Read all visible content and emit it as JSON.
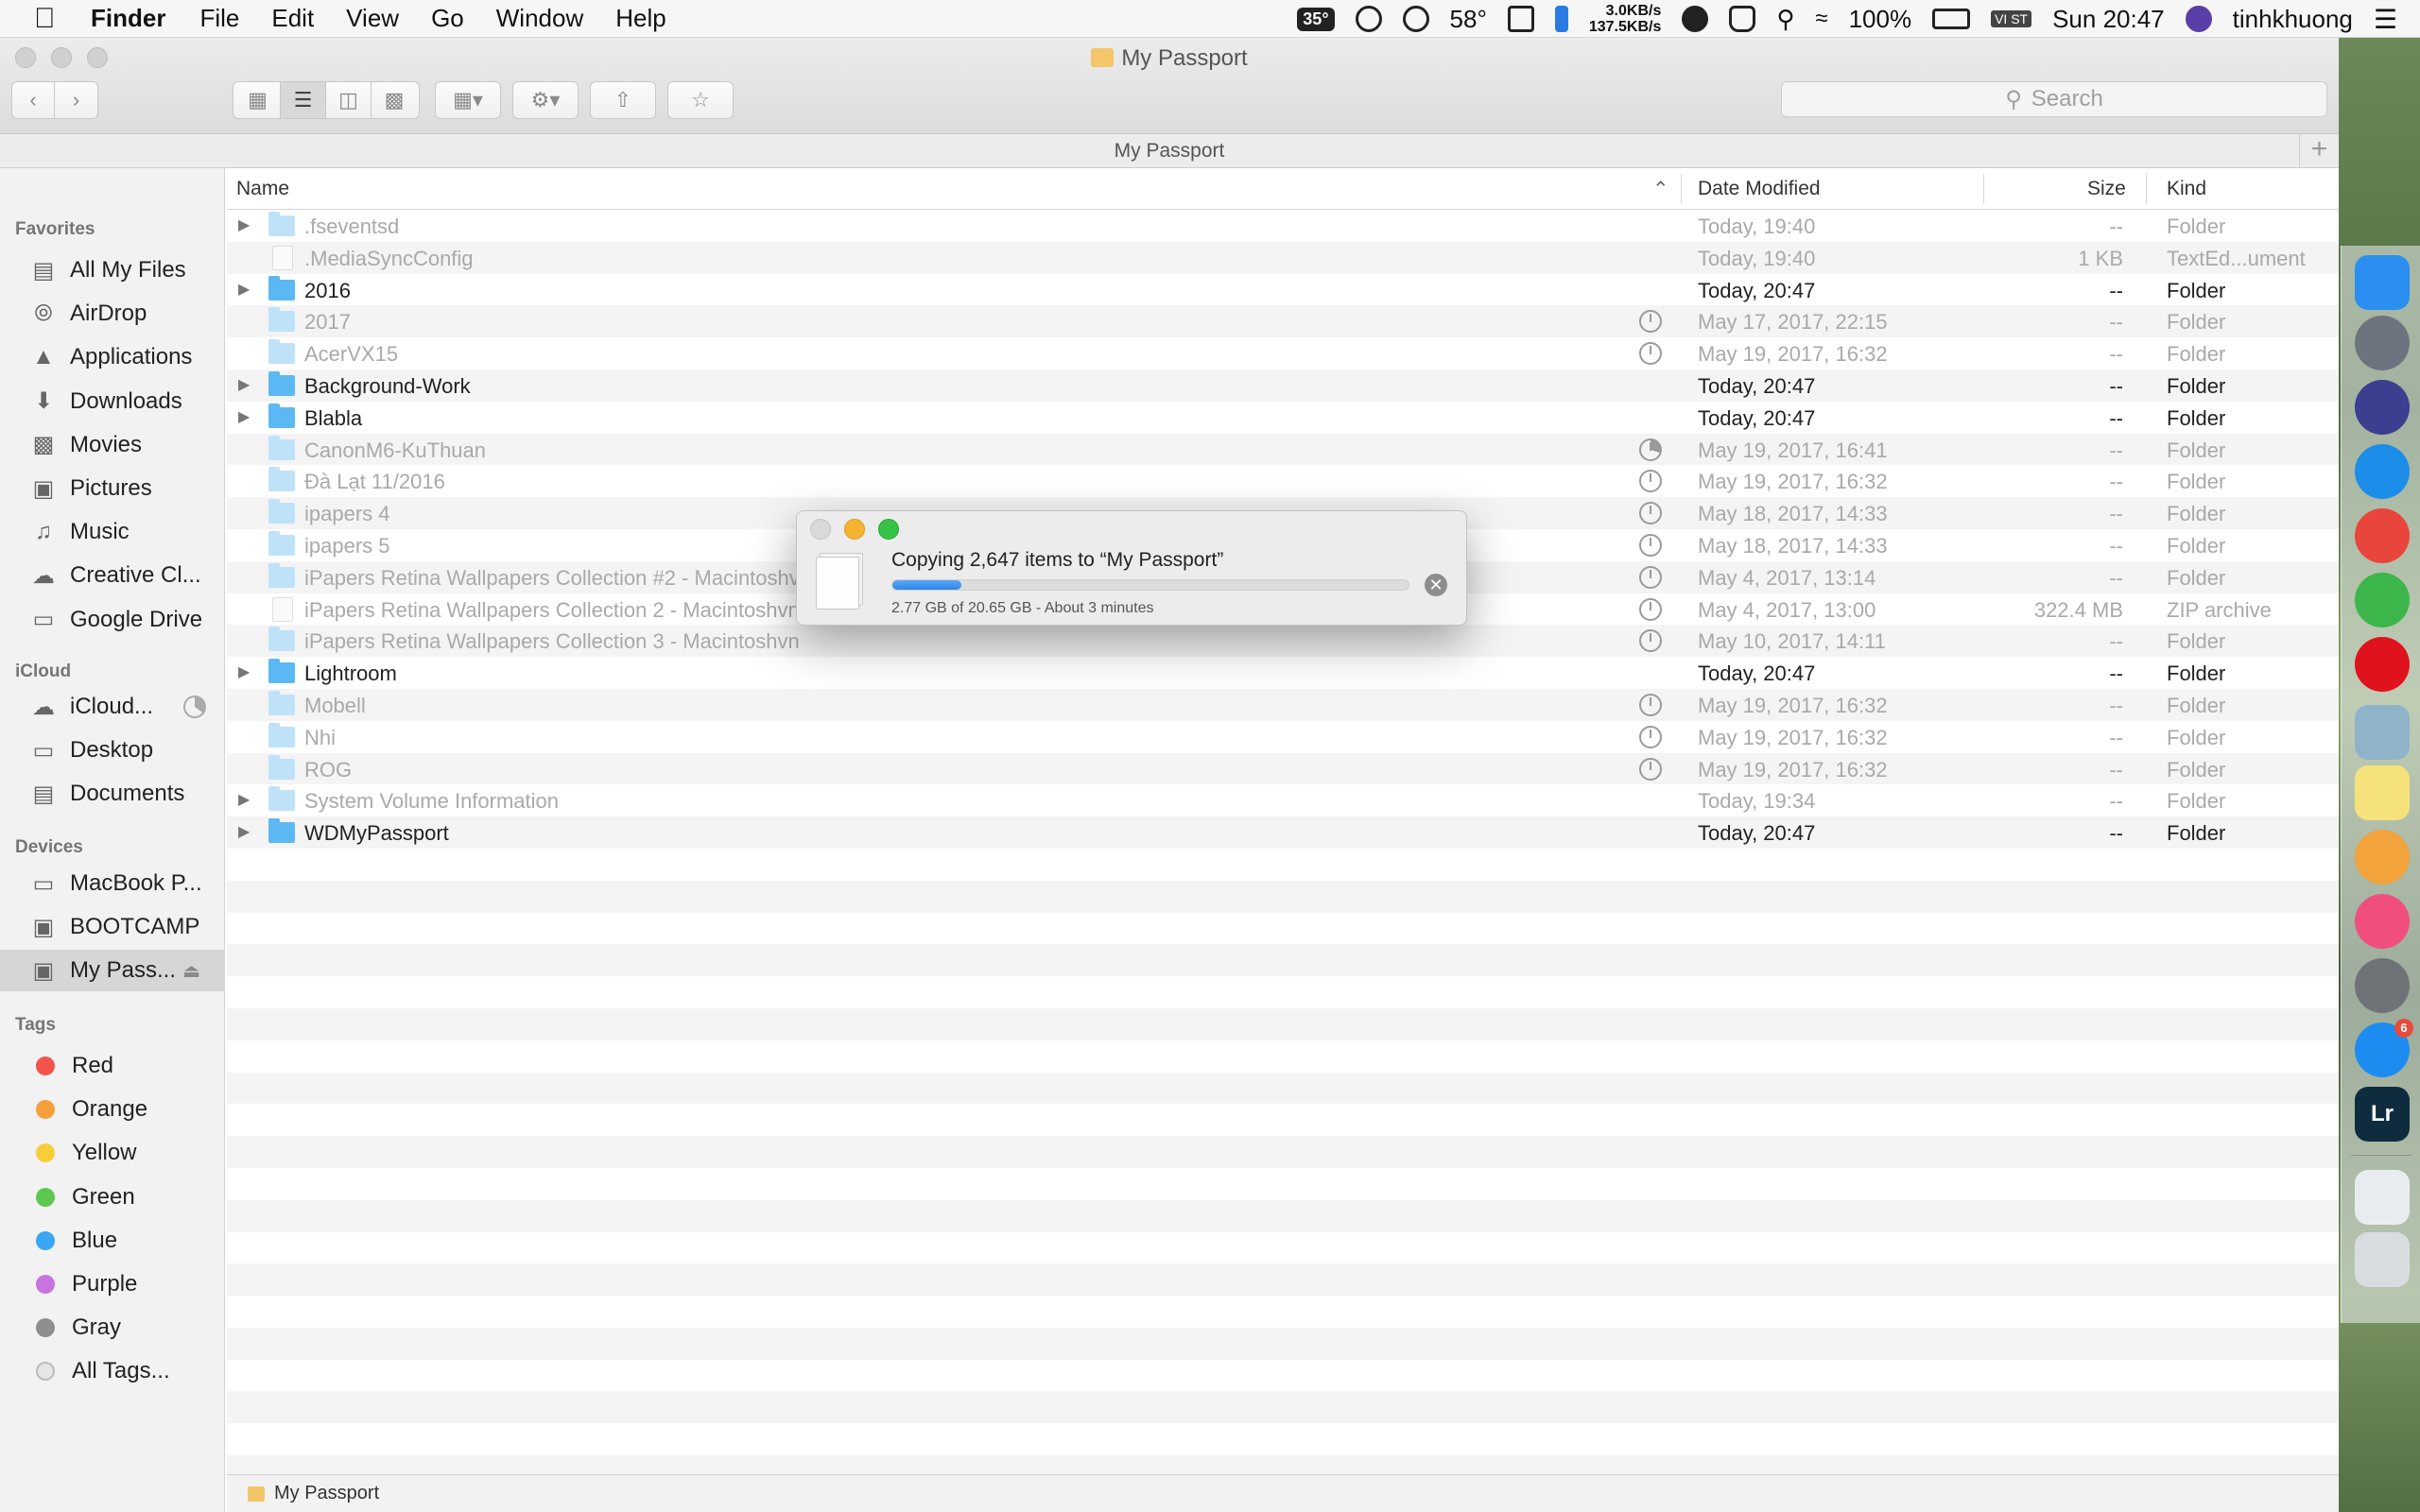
{
  "menubar": {
    "app_name": "Finder",
    "menus": [
      "File",
      "Edit",
      "View",
      "Go",
      "Window",
      "Help"
    ],
    "temperature_badge": "35°",
    "weather": "58°",
    "net_up": "3.0KB/s",
    "net_down": "137.5KB/s",
    "battery": "100%",
    "input_method": "VI ST",
    "clock": "Sun 20:47",
    "user": "tinhkhuong"
  },
  "window": {
    "title": "My Passport",
    "path_title": "My Passport",
    "search_placeholder": "Search",
    "status_path": "My Passport"
  },
  "sidebar": {
    "favorites_header": "Favorites",
    "favorites": [
      {
        "label": "All My Files",
        "icon": "all-files-icon"
      },
      {
        "label": "AirDrop",
        "icon": "airdrop-icon"
      },
      {
        "label": "Applications",
        "icon": "applications-icon"
      },
      {
        "label": "Downloads",
        "icon": "downloads-icon"
      },
      {
        "label": "Movies",
        "icon": "movies-icon"
      },
      {
        "label": "Pictures",
        "icon": "pictures-icon"
      },
      {
        "label": "Music",
        "icon": "music-icon"
      },
      {
        "label": "Creative Cl...",
        "icon": "creative-cloud-icon"
      },
      {
        "label": "Google Drive",
        "icon": "folder-icon"
      }
    ],
    "icloud_header": "iCloud",
    "icloud": [
      {
        "label": "iCloud...",
        "icon": "icloud-icon"
      },
      {
        "label": "Desktop",
        "icon": "desktop-icon"
      },
      {
        "label": "Documents",
        "icon": "documents-icon"
      }
    ],
    "devices_header": "Devices",
    "devices": [
      {
        "label": "MacBook P...",
        "icon": "laptop-icon"
      },
      {
        "label": "BOOTCAMP",
        "icon": "disk-icon"
      },
      {
        "label": "My Pass...",
        "icon": "disk-icon",
        "selected": true
      }
    ],
    "tags_header": "Tags",
    "tags": [
      {
        "label": "Red",
        "color": "#f2544c"
      },
      {
        "label": "Orange",
        "color": "#f6a03c"
      },
      {
        "label": "Yellow",
        "color": "#f7cd3a"
      },
      {
        "label": "Green",
        "color": "#5cc84f"
      },
      {
        "label": "Blue",
        "color": "#3aa7f4"
      },
      {
        "label": "Purple",
        "color": "#c874e0"
      },
      {
        "label": "Gray",
        "color": "#8e8e8e"
      },
      {
        "label": "All Tags...",
        "color": "#e6e6e6"
      }
    ]
  },
  "list": {
    "columns": {
      "name": "Name",
      "date": "Date Modified",
      "size": "Size",
      "kind": "Kind"
    },
    "rows": [
      {
        "name": ".fseventsd",
        "date": "Today, 19:40",
        "size": "--",
        "kind": "Folder",
        "dim": true,
        "disclosure": true,
        "type": "folder",
        "clock": ""
      },
      {
        "name": ".MediaSyncConfig",
        "date": "Today, 19:40",
        "size": "1 KB",
        "kind": "TextEd...ument",
        "dim": true,
        "disclosure": false,
        "type": "file",
        "clock": ""
      },
      {
        "name": "2016",
        "date": "Today, 20:47",
        "size": "--",
        "kind": "Folder",
        "dim": false,
        "disclosure": true,
        "type": "folder",
        "clock": ""
      },
      {
        "name": "2017",
        "date": "May 17, 2017, 22:15",
        "size": "--",
        "kind": "Folder",
        "dim": true,
        "disclosure": false,
        "type": "folder",
        "clock": "clock"
      },
      {
        "name": "AcerVX15",
        "date": "May 19, 2017, 16:32",
        "size": "--",
        "kind": "Folder",
        "dim": true,
        "disclosure": false,
        "type": "folder",
        "clock": "clock"
      },
      {
        "name": "Background-Work",
        "date": "Today, 20:47",
        "size": "--",
        "kind": "Folder",
        "dim": false,
        "disclosure": true,
        "type": "folder",
        "clock": ""
      },
      {
        "name": "Blabla",
        "date": "Today, 20:47",
        "size": "--",
        "kind": "Folder",
        "dim": false,
        "disclosure": true,
        "type": "folder",
        "clock": ""
      },
      {
        "name": "CanonM6-KuThuan",
        "date": "May 19, 2017, 16:41",
        "size": "--",
        "kind": "Folder",
        "dim": true,
        "disclosure": false,
        "type": "folder",
        "clock": "pie"
      },
      {
        "name": "Đà Lạt 11/2016",
        "date": "May 19, 2017, 16:32",
        "size": "--",
        "kind": "Folder",
        "dim": true,
        "disclosure": false,
        "type": "folder",
        "clock": "clock"
      },
      {
        "name": "ipapers 4",
        "date": "May 18, 2017, 14:33",
        "size": "--",
        "kind": "Folder",
        "dim": true,
        "disclosure": false,
        "type": "folder",
        "clock": "clock"
      },
      {
        "name": "ipapers 5",
        "date": "May 18, 2017, 14:33",
        "size": "--",
        "kind": "Folder",
        "dim": true,
        "disclosure": false,
        "type": "folder",
        "clock": "clock"
      },
      {
        "name": "iPapers Retina Wallpapers Collection #2 - Macintoshvn",
        "date": "May 4, 2017, 13:14",
        "size": "--",
        "kind": "Folder",
        "dim": true,
        "disclosure": false,
        "type": "folder",
        "clock": "clock"
      },
      {
        "name": "iPapers Retina Wallpapers Collection 2 - Macintoshvn.zip",
        "date": "May 4, 2017, 13:00",
        "size": "322.4 MB",
        "kind": "ZIP archive",
        "dim": true,
        "disclosure": false,
        "type": "file",
        "clock": "clock"
      },
      {
        "name": "iPapers Retina Wallpapers Collection 3 - Macintoshvn",
        "date": "May 10, 2017, 14:11",
        "size": "--",
        "kind": "Folder",
        "dim": true,
        "disclosure": false,
        "type": "folder",
        "clock": "clock"
      },
      {
        "name": "Lightroom",
        "date": "Today, 20:47",
        "size": "--",
        "kind": "Folder",
        "dim": false,
        "disclosure": true,
        "type": "folder",
        "clock": ""
      },
      {
        "name": "Mobell",
        "date": "May 19, 2017, 16:32",
        "size": "--",
        "kind": "Folder",
        "dim": true,
        "disclosure": false,
        "type": "folder",
        "clock": "clock"
      },
      {
        "name": "Nhi",
        "date": "May 19, 2017, 16:32",
        "size": "--",
        "kind": "Folder",
        "dim": true,
        "disclosure": false,
        "type": "folder",
        "clock": "clock"
      },
      {
        "name": "ROG",
        "date": "May 19, 2017, 16:32",
        "size": "--",
        "kind": "Folder",
        "dim": true,
        "disclosure": false,
        "type": "folder",
        "clock": "clock"
      },
      {
        "name": "System Volume Information",
        "date": "Today, 19:34",
        "size": "--",
        "kind": "Folder",
        "dim": true,
        "disclosure": true,
        "type": "folder",
        "clock": ""
      },
      {
        "name": "WDMyPassport",
        "date": "Today, 20:47",
        "size": "--",
        "kind": "Folder",
        "dim": false,
        "disclosure": true,
        "type": "folder",
        "clock": ""
      }
    ]
  },
  "copy_dialog": {
    "title": "Copying 2,647 items to “My Passport”",
    "progress": 0.134,
    "detail": "2.77 GB of 20.65 GB - About 3 minutes",
    "progress_color": "#3d8ff0"
  },
  "dock": {
    "items": [
      {
        "name": "finder-icon",
        "label": "",
        "color": "#2a8ff0",
        "round": false
      },
      {
        "name": "launchpad-icon",
        "label": "",
        "color": "#6d7480",
        "round": true
      },
      {
        "name": "siri-icon",
        "label": "",
        "color": "#3a3f8f",
        "round": true
      },
      {
        "name": "safari-icon",
        "label": "",
        "color": "#1c8de8",
        "round": true
      },
      {
        "name": "chrome-icon",
        "label": "",
        "color": "#e8453c",
        "round": true
      },
      {
        "name": "green-app-icon",
        "label": "",
        "color": "#3cb54a",
        "round": true
      },
      {
        "name": "opera-icon",
        "label": "",
        "color": "#e0121e",
        "round": true
      },
      {
        "name": "preview-icon",
        "label": "",
        "color": "#8fb3c9",
        "round": false
      },
      {
        "name": "notes-icon",
        "label": "",
        "color": "#f6e27a",
        "round": false
      },
      {
        "name": "photos-icon",
        "label": "",
        "color": "#f2a33c",
        "round": true
      },
      {
        "name": "itunes-icon",
        "label": "",
        "color": "#f04f7e",
        "round": true
      },
      {
        "name": "system-preferences-icon",
        "label": "",
        "color": "#6f7378",
        "round": true
      },
      {
        "name": "app-store-icon",
        "label": "",
        "color": "#1d8cf0",
        "round": true,
        "badge": "6"
      },
      {
        "name": "lightroom-icon",
        "label": "Lr",
        "color": "#0f2c3f",
        "round": false
      },
      {
        "name": "downloads-stack-icon",
        "label": "",
        "color": "#e9ecef",
        "round": false
      },
      {
        "name": "trash-icon",
        "label": "",
        "color": "#d9dde0",
        "round": false
      }
    ]
  }
}
